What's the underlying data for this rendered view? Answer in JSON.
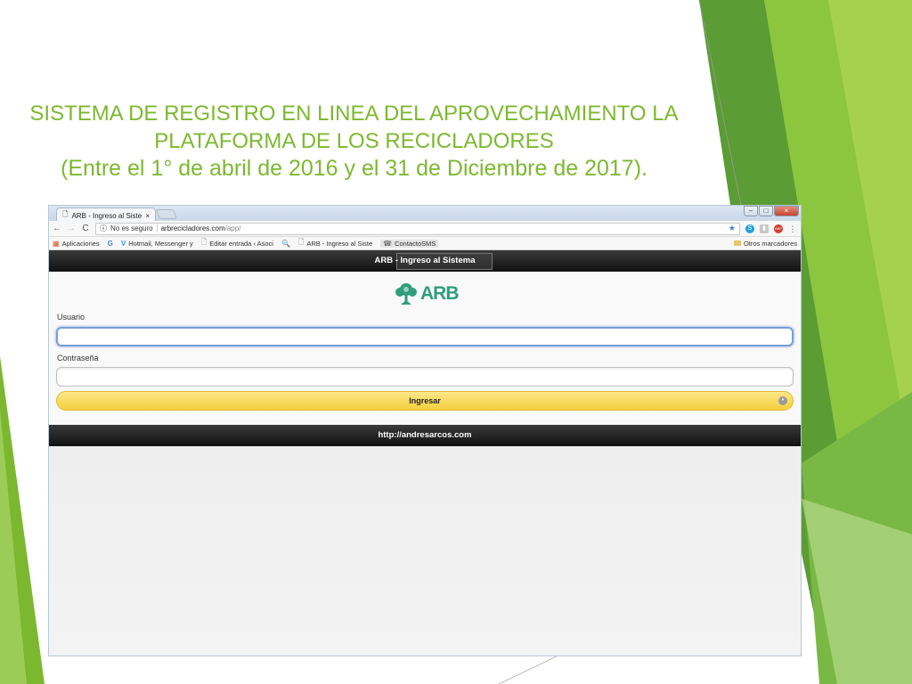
{
  "slide": {
    "title_line1": "SISTEMA DE REGISTRO EN LINEA DEL APROVECHAMIENTO LA",
    "title_line2": "PLATAFORMA DE LOS RECICLADORES",
    "title_line3": "(Entre el 1° de abril de 2016 y el 31 de Diciembre de 2017).",
    "accent_color": "#7cb82f"
  },
  "browser": {
    "tab_title": "ARB - Ingreso al Sistema",
    "tab_close": "×",
    "window_controls": {
      "minimize": "–",
      "maximize": "□",
      "close": "×"
    },
    "nav": {
      "back": "←",
      "forward": "→",
      "reload": "C"
    },
    "address": {
      "security_text": "No es seguro",
      "url_host": "arbrecicladores.com",
      "url_path": "/app/"
    },
    "bookmark_star": "★",
    "extensions": {
      "skype": "S",
      "misc": "▮",
      "abp": "ABP",
      "menu": "⋮"
    },
    "bookmarks": [
      {
        "icon": "▦",
        "label": "Aplicaciones"
      },
      {
        "icon": "G",
        "label": ""
      },
      {
        "icon": "V",
        "label": "Hotmail, Messenger y"
      },
      {
        "icon": "🗋",
        "label": "Editar entrada ‹ Asoci"
      },
      {
        "icon": "🔍",
        "label": ""
      },
      {
        "icon": "🗋",
        "label": "ARB - Ingreso al Siste"
      },
      {
        "icon": "☎",
        "label": "ContactoSMS"
      }
    ],
    "other_bookmarks": "Otros marcadores"
  },
  "app": {
    "header_title": "ARB - Ingreso al Sistema",
    "logo_text": "ARB",
    "logo_color": "#2f9e7a",
    "usuario_label": "Usuario",
    "usuario_value": "",
    "password_label": "Contraseña",
    "password_value": "",
    "submit_label": "Ingresar",
    "footer_link": "http://andresarcos.com",
    "button_color": "#f5cf3e"
  }
}
